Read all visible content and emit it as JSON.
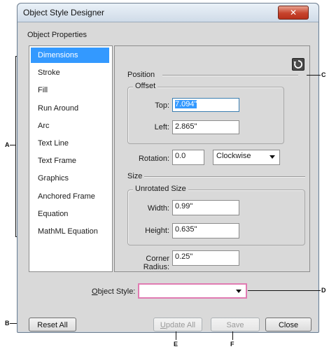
{
  "window": {
    "title": "Object Style Designer",
    "close_symbol": "✕",
    "section_label": "Object Properties"
  },
  "sidebar": {
    "items": [
      {
        "label": "Dimensions",
        "selected": true
      },
      {
        "label": "Stroke"
      },
      {
        "label": "Fill"
      },
      {
        "label": "Run Around"
      },
      {
        "label": "Arc"
      },
      {
        "label": "Text Line"
      },
      {
        "label": "Text Frame"
      },
      {
        "label": "Graphics"
      },
      {
        "label": "Anchored Frame"
      },
      {
        "label": "Equation"
      },
      {
        "label": "MathML Equation"
      }
    ]
  },
  "position": {
    "heading": "Position",
    "offset_legend": "Offset",
    "top_label": "Top:",
    "top_value": "7.094\"",
    "left_label": "Left:",
    "left_value": "2.865\"",
    "rotation_label": "Rotation:",
    "rotation_value": "0.0",
    "direction_value": "Clockwise"
  },
  "size": {
    "heading": "Size",
    "unrotated_legend": "Unrotated Size",
    "width_label": "Width:",
    "width_value": "0.99\"",
    "height_label": "Height:",
    "height_value": "0.635\"",
    "corner_label": "Corner Radius:",
    "corner_value": "0.25\""
  },
  "bottom": {
    "style_label_underlined": "O",
    "style_label_rest": "bject Style:",
    "style_value": "",
    "reset_label": "Reset All",
    "update_label_underlined": "U",
    "update_label_rest": "pdate All",
    "save_label": "Save",
    "close_label": "Close"
  },
  "callouts": {
    "a": "A",
    "b": "B",
    "c": "C",
    "d": "D",
    "e": "E",
    "f": "F"
  },
  "icons": {
    "refresh": "refresh-icon",
    "dropdown": "chevron-down-icon",
    "close": "close-icon"
  },
  "colors": {
    "selection": "#3399ff",
    "highlight_border": "#e07bb2",
    "window_face": "#d9d9d9",
    "close_button": "#c7432c"
  }
}
